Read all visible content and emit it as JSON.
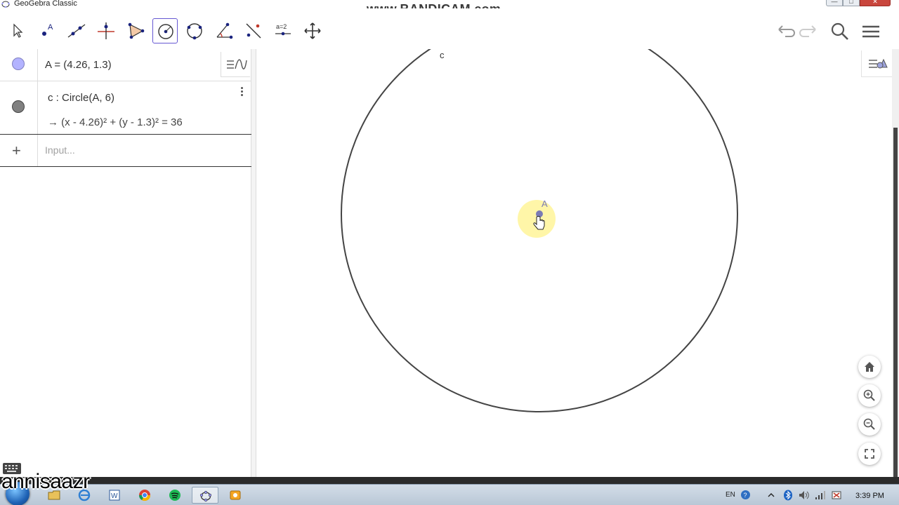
{
  "window": {
    "title": "GeoGebra Classic",
    "watermark": "www.BANDICAM.com"
  },
  "toolbar": {
    "tools": [
      {
        "id": "move",
        "icon": "arrow-pointer-icon"
      },
      {
        "id": "point",
        "icon": "point-icon"
      },
      {
        "id": "line",
        "icon": "line-icon"
      },
      {
        "id": "perpendicular",
        "icon": "perpendicular-line-icon"
      },
      {
        "id": "polygon",
        "icon": "polygon-icon"
      },
      {
        "id": "circle-center-point",
        "icon": "circle-center-point-icon",
        "selected": true
      },
      {
        "id": "circle-three-points",
        "icon": "circle-three-points-icon"
      },
      {
        "id": "angle",
        "icon": "angle-icon"
      },
      {
        "id": "reflect",
        "icon": "reflect-icon"
      },
      {
        "id": "slider",
        "icon": "slider-icon",
        "label": "a=2"
      },
      {
        "id": "move-graphics",
        "icon": "move-graphics-icon"
      }
    ],
    "right_icons": [
      "undo-icon",
      "redo-icon",
      "search-icon",
      "menu-icon"
    ]
  },
  "algebra": {
    "rows": [
      {
        "marker_color": "#b3b3ff",
        "definition": "A = (4.26, 1.3)"
      },
      {
        "marker_color": "#808080",
        "definition": "c : Circle(A, 6)",
        "value": "→  (x - 4.26)² + (y - 1.3)² = 36"
      }
    ],
    "input_placeholder": "Input...",
    "add_symbol": "+"
  },
  "graphics": {
    "labels": {
      "circle": "c",
      "point": "A"
    },
    "colors": {
      "circle": "#444444",
      "point": "#7b7bb5",
      "highlight": "#fff6a8"
    }
  },
  "overlay": {
    "username": "annisaazr"
  },
  "taskbar": {
    "language": "EN",
    "time": "3:39 PM"
  }
}
